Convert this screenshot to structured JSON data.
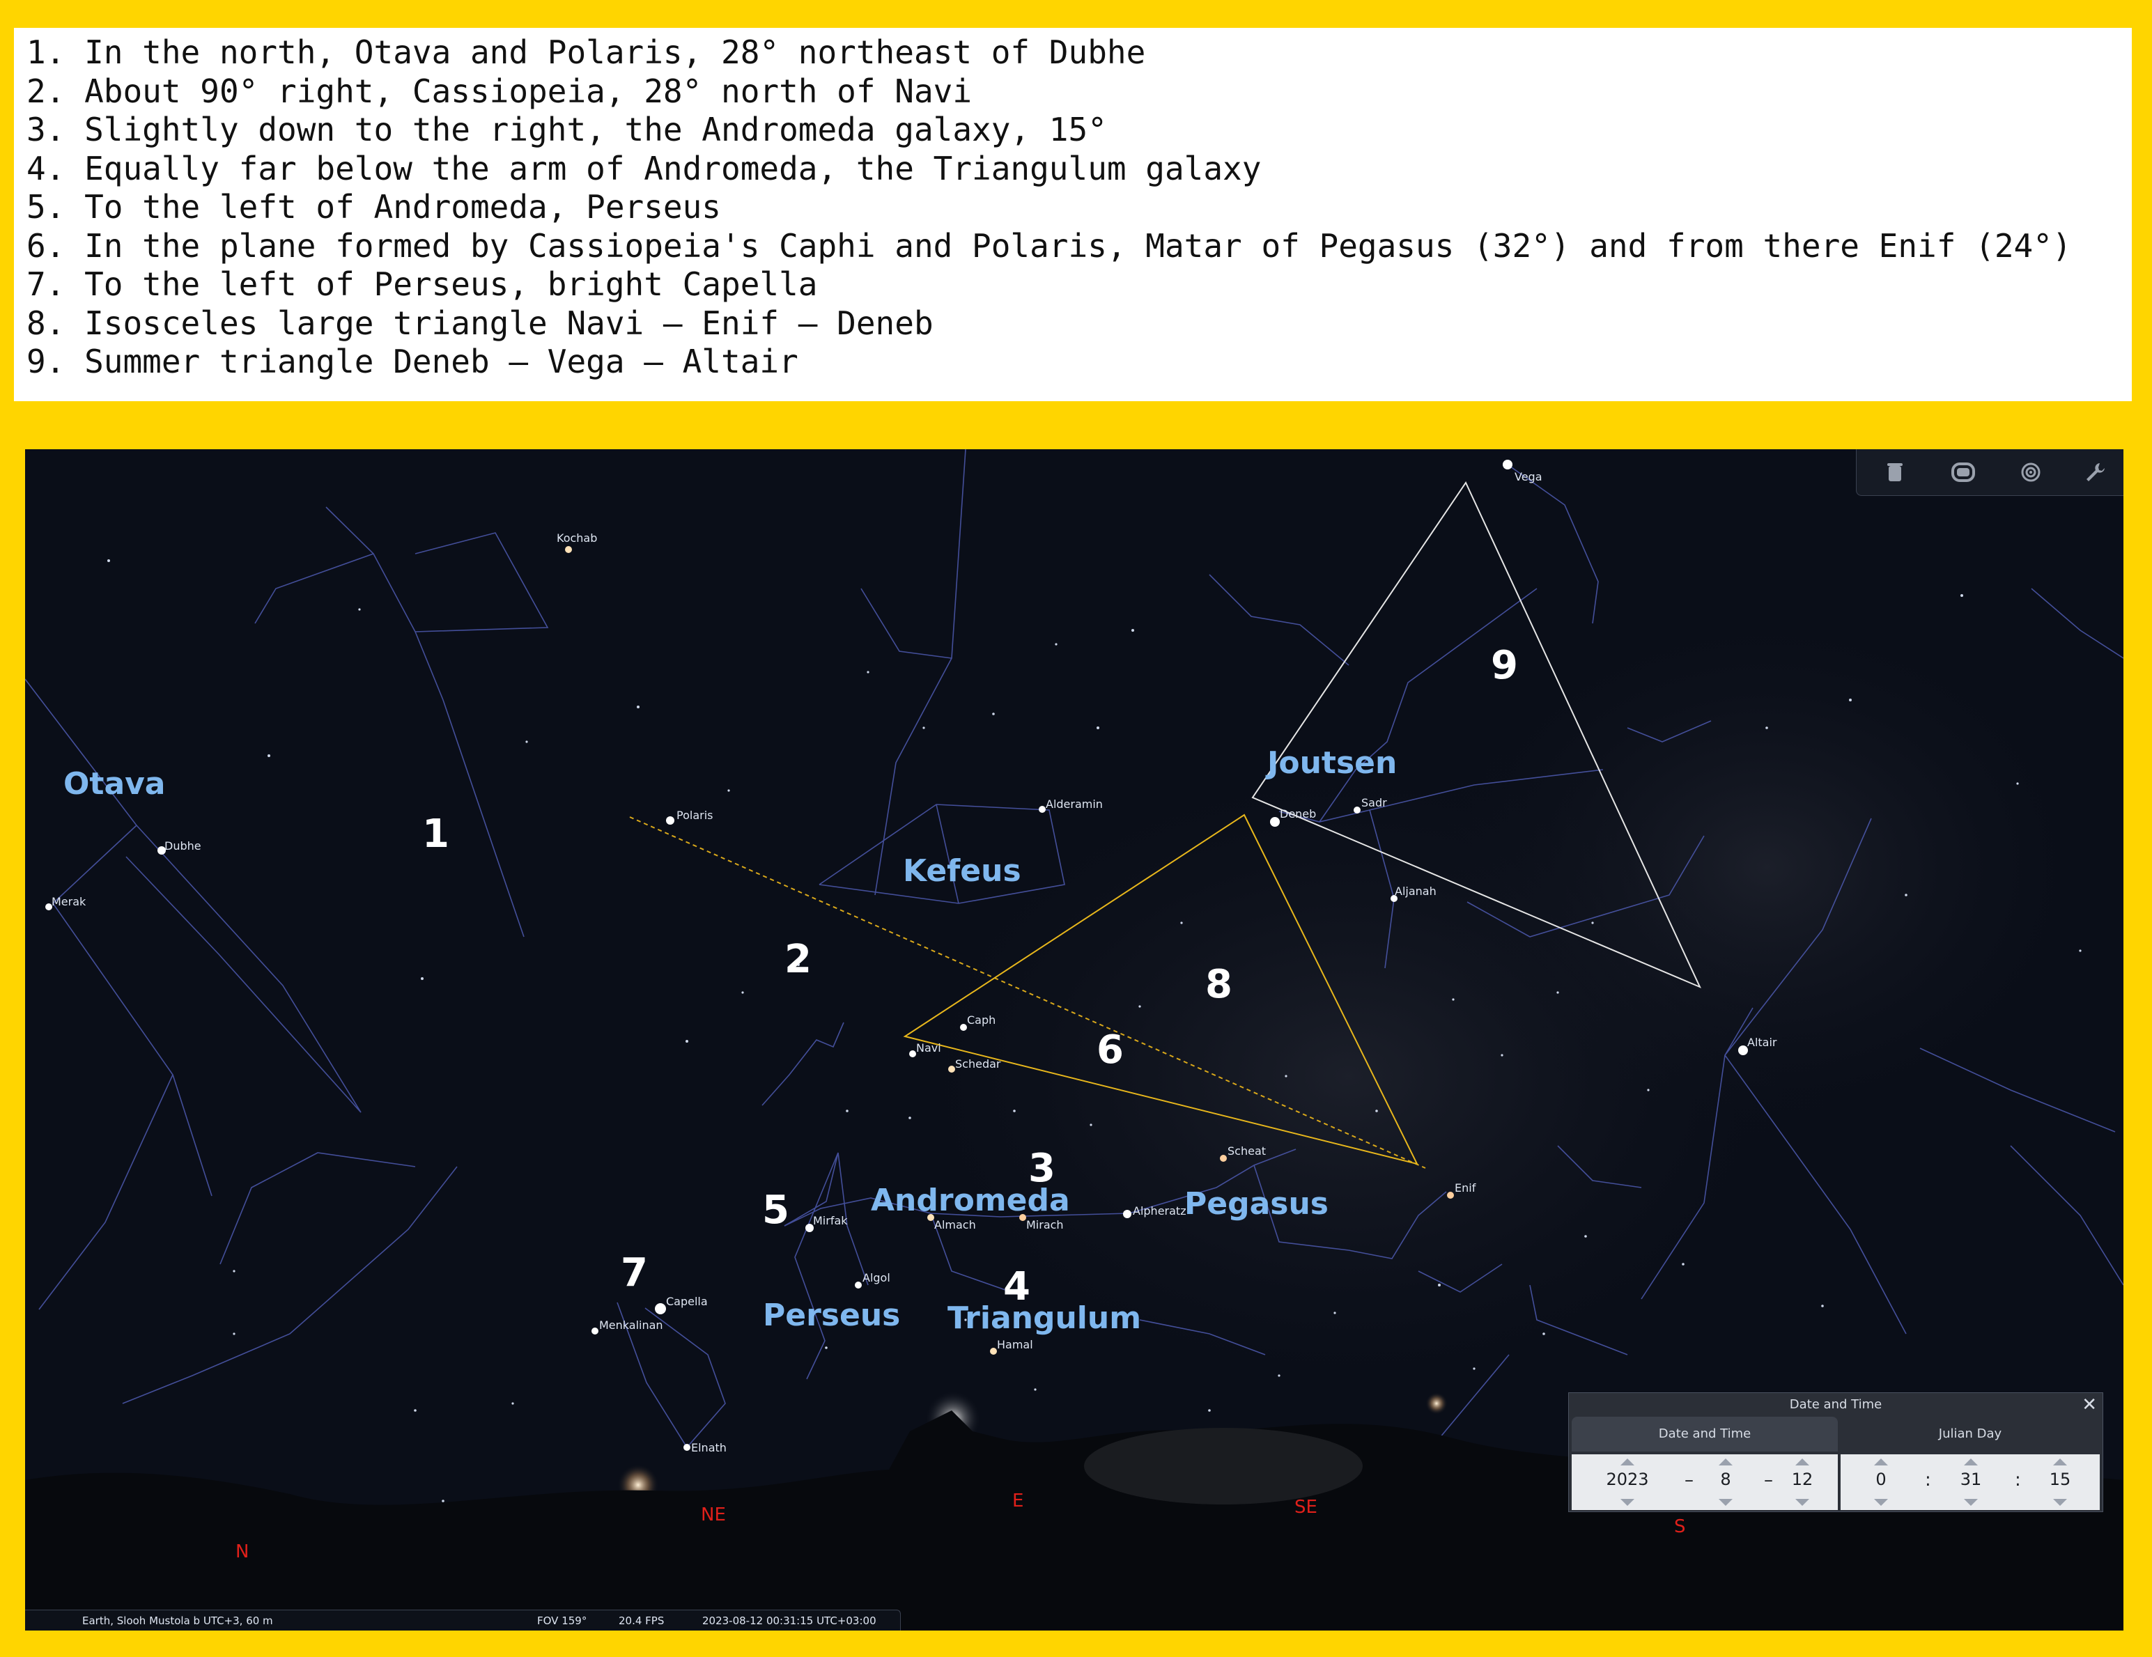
{
  "notes": [
    "1. In the north, Otava and Polaris, 28° northeast of Dubhe",
    "2. About 90° right, Cassiopeia, 28° north of Navi",
    "3. Slightly down to the right, the Andromeda galaxy, 15°",
    "4. Equally far below the arm of Andromeda, the Triangulum galaxy",
    "5. To the left of Andromeda, Perseus",
    "6. In the plane formed by Cassiopeia's Caphi and Polaris, Matar of Pegasus (32°) and from there Enif (24°)",
    "7. To the left of Perseus, bright Capella",
    "8. Isosceles large triangle Navi – Enif – Deneb",
    "9. Summer triangle Deneb – Vega – Altair"
  ],
  "sky": {
    "constellations": {
      "otava": "Otava",
      "joutsen": "Joutsen",
      "kefeus": "Kefeus",
      "andromeda": "Andromeda",
      "pegasus": "Pegasus",
      "perseus": "Perseus",
      "triangulum": "Triangulum"
    },
    "stars": {
      "vega": "Vega",
      "kochab": "Kochab",
      "polaris": "Polaris",
      "dubhe": "Dubhe",
      "merak": "Merak",
      "alderamin": "Alderamin",
      "deneb": "Deneb",
      "sadr": "Sadr",
      "aljanah": "Aljanah",
      "altair": "Altair",
      "caph": "Caph",
      "navi": "Navi",
      "schedar": "Schedar",
      "scheat": "Scheat",
      "enif": "Enif",
      "alpheratz": "Alpheratz",
      "almach": "Almach",
      "mirach": "Mirach",
      "mirfak": "Mirfak",
      "algol": "Algol",
      "capella": "Capella",
      "menkalinan": "Menkalinan",
      "hamal": "Hamal",
      "elnath": "Elnath"
    },
    "numbers": {
      "n1": "1",
      "n2": "2",
      "n3": "3",
      "n4": "4",
      "n5": "5",
      "n6": "6",
      "n7": "7",
      "n8": "8",
      "n9": "9"
    },
    "compass": {
      "n": "N",
      "ne": "NE",
      "e": "E",
      "se": "SE",
      "s": "S"
    }
  },
  "toolbar": {
    "icons": [
      "trash-icon",
      "fullscreen-icon",
      "target-icon",
      "wrench-icon"
    ]
  },
  "statusbar": {
    "location": "Earth, Slooh Mustola b UTC+3, 60 m",
    "fov": "FOV 159°",
    "fps": "20.4 FPS",
    "datetime": "2023-08-12 00:31:15 UTC+03:00"
  },
  "datetime_panel": {
    "title": "Date and Time",
    "tab_date": "Date and Time",
    "tab_julian": "Julian Day",
    "year": "2023",
    "month": "8",
    "day": "12",
    "hour": "0",
    "minute": "31",
    "second": "15",
    "date_sep": "–",
    "time_sep": ":"
  },
  "colors": {
    "background": "#FFD500",
    "sky": "#0a0e18",
    "constellation_label": "#7fb7ee",
    "triangle_gold": "#e8b71c",
    "triangle_white": "#e6e6e6",
    "compass": "#e0201a"
  }
}
